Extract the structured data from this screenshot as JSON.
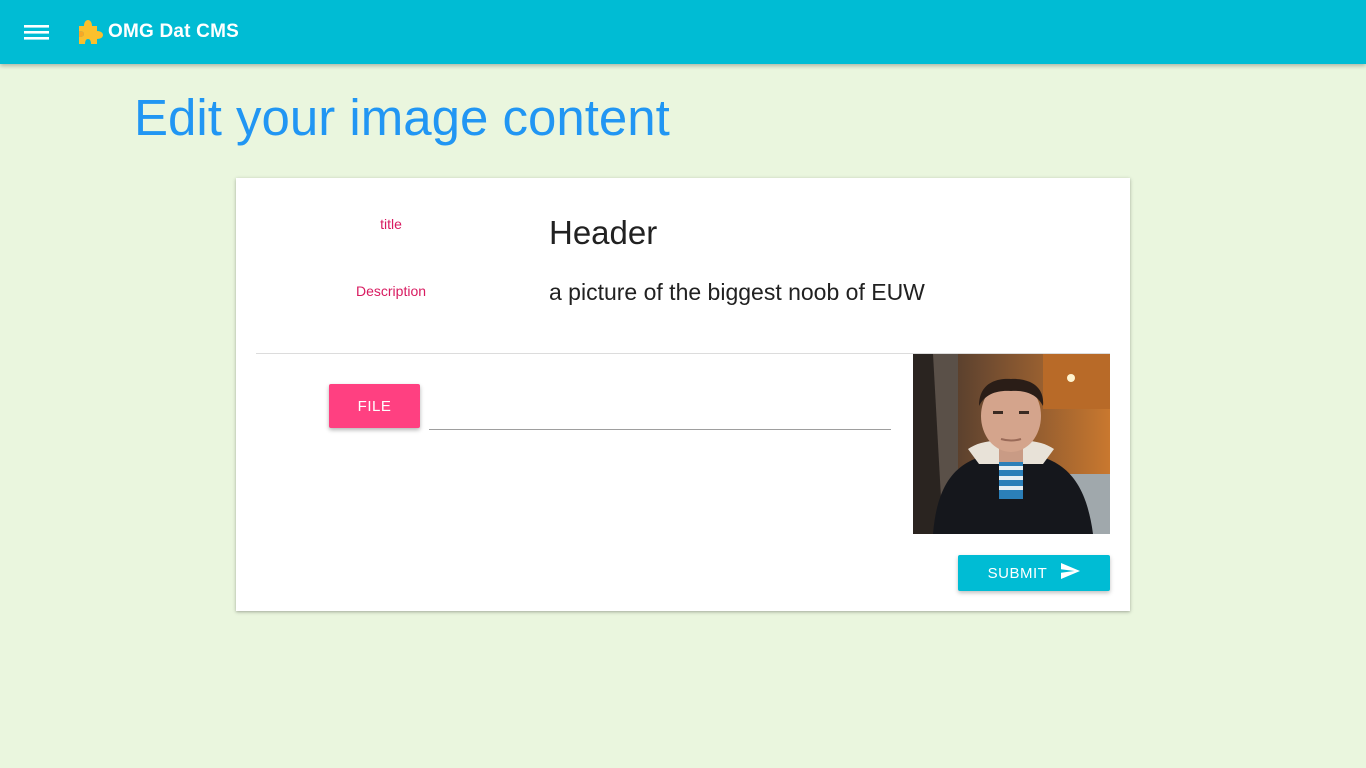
{
  "appbar": {
    "title": "OMG Dat CMS",
    "menu_icon": "menu-icon",
    "logo_icon": "puzzle-piece-icon",
    "background_color": "#00bcd4",
    "logo_color": "#fbc02d"
  },
  "page": {
    "title": "Edit your image content",
    "title_color": "#2196f3",
    "background_color": "#eaf6de"
  },
  "form": {
    "title_label": "title",
    "title_value": "Header",
    "description_label": "Description",
    "description_value": "a picture of the biggest noob of EUW",
    "label_color": "#d81b60",
    "file_button_label": "FILE",
    "file_button_color": "#ff4081",
    "file_input_value": "",
    "submit_label": "SUBMIT",
    "submit_icon": "send-icon",
    "submit_color": "#00bcd4",
    "preview_image": "portrait-photo"
  }
}
